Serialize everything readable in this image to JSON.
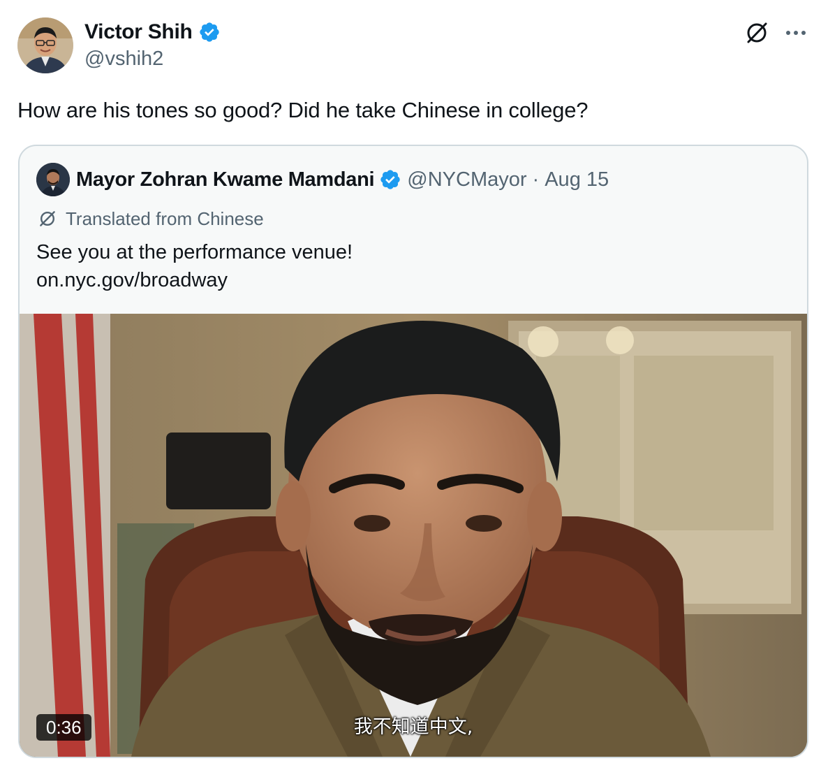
{
  "author": {
    "name": "Victor Shih",
    "handle": "@vshih2",
    "verified": true
  },
  "tweet_text": "How are his tones so good? Did he take Chinese in college?",
  "header_icons": [
    "translate-icon",
    "more-options-icon"
  ],
  "quoted_tweet": {
    "name": "Mayor Zohran Kwame Mamdani",
    "handle": "@NYCMayor",
    "separator": "·",
    "date": "Aug 15",
    "verified": true,
    "translated_label": "Translated from Chinese",
    "text_lines": [
      "See you at the performance venue!",
      "on.nyc.gov/broadway"
    ],
    "video": {
      "duration": "0:36",
      "subtitle": "我不知道中文,"
    }
  },
  "colors": {
    "text_primary": "#0f1419",
    "text_secondary": "#536471",
    "verified_blue": "#1d9bf0",
    "border": "#cfd9de",
    "quote_background": "#f7f9f9"
  }
}
